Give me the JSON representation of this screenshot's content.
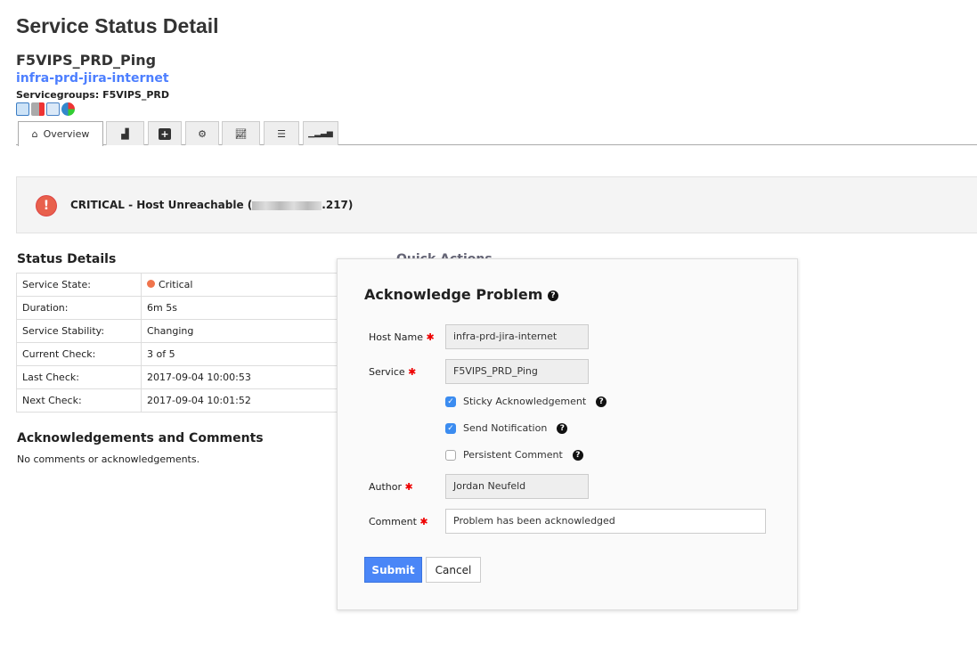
{
  "page": {
    "title": "Service Status Detail",
    "service": "F5VIPS_PRD_Ping",
    "host": "infra-prd-jira-internet",
    "servicegroups": "Servicegroups: F5VIPS_PRD"
  },
  "tabs": [
    {
      "label": "Overview",
      "icon": "home-icon"
    },
    {
      "icon": "area-chart-icon"
    },
    {
      "icon": "plus-square-icon"
    },
    {
      "icon": "gear-icon"
    },
    {
      "icon": "line-chart-icon"
    },
    {
      "icon": "server-icon"
    },
    {
      "icon": "signal-icon"
    }
  ],
  "alert": {
    "prefix": "CRITICAL - Host Unreachable (",
    "suffix": ".217)",
    "color": "#e8604c"
  },
  "status": {
    "heading": "Status Details",
    "rows": [
      {
        "label": "Service State:",
        "value": "Critical"
      },
      {
        "label": "Duration:",
        "value": "6m 5s"
      },
      {
        "label": "Service Stability:",
        "value": "Changing"
      },
      {
        "label": "Current Check:",
        "value": "3 of 5"
      },
      {
        "label": "Last Check:",
        "value": "2017-09-04 10:00:53"
      },
      {
        "label": "Next Check:",
        "value": "2017-09-04 10:01:52"
      }
    ]
  },
  "quick_actions": "Quick Actions",
  "ack": {
    "heading": "Acknowledgements and Comments",
    "empty": "No comments or acknowledgements."
  },
  "modal": {
    "title": "Acknowledge Problem",
    "host_label": "Host Name",
    "host_value": "infra-prd-jira-internet",
    "service_label": "Service",
    "service_value": "F5VIPS_PRD_Ping",
    "sticky": {
      "label": "Sticky Acknowledgement",
      "checked": true
    },
    "notify": {
      "label": "Send Notification",
      "checked": true
    },
    "persistent": {
      "label": "Persistent Comment",
      "checked": false
    },
    "author_label": "Author",
    "author_value": "Jordan Neufeld",
    "comment_label": "Comment",
    "comment_value": "Problem has been acknowledged",
    "submit": "Submit",
    "cancel": "Cancel",
    "accent": "#4a86f7"
  }
}
